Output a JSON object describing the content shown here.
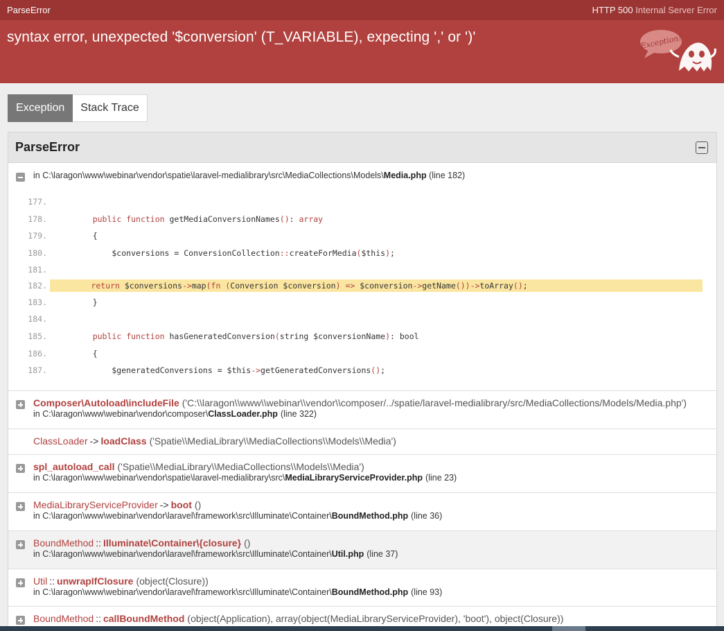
{
  "header": {
    "error_class": "ParseError",
    "http_code": "HTTP 500",
    "http_text": "Internal Server Error",
    "message": "syntax error, unexpected '$conversion' (T_VARIABLE), expecting ',' or ')'",
    "mascot_text": "Exception!"
  },
  "tabs": [
    {
      "label": "Exception",
      "active": true
    },
    {
      "label": "Stack Trace",
      "active": false
    }
  ],
  "panel": {
    "title": "ParseError",
    "location": {
      "prefix": "in C:\\laragon\\www\\webinar\\vendor\\spatie\\laravel-medialibrary\\src\\MediaCollections\\Models\\",
      "file": "Media.php",
      "line": "(line 182)"
    },
    "code": [
      {
        "num": "177.",
        "text": ""
      },
      {
        "num": "178.",
        "text": "    public function getMediaConversionNames(): array"
      },
      {
        "num": "179.",
        "text": "    {"
      },
      {
        "num": "180.",
        "text": "        $conversions = ConversionCollection::createForMedia($this);"
      },
      {
        "num": "181.",
        "text": ""
      },
      {
        "num": "182.",
        "text": "        return $conversions->map(fn (Conversion $conversion) => $conversion->getName())->toArray();",
        "highlight": true
      },
      {
        "num": "183.",
        "text": "    }"
      },
      {
        "num": "184.",
        "text": ""
      },
      {
        "num": "185.",
        "text": "    public function hasGeneratedConversion(string $conversionName): bool"
      },
      {
        "num": "186.",
        "text": "    {"
      },
      {
        "num": "187.",
        "text": "        $generatedConversions = $this->getGeneratedConversions();"
      }
    ]
  },
  "trace": [
    {
      "cls": "",
      "sep": "",
      "fn": "Composer\\Autoload\\includeFile",
      "args": "('C:\\\\laragon\\\\www\\\\webinar\\\\vendor\\\\composer/../spatie/laravel-medialibrary/src/MediaCollections/Models/Media.php')",
      "path": "in C:\\laragon\\www\\webinar\\vendor\\composer\\",
      "file": "ClassLoader.php",
      "line": "(line 322)"
    },
    {
      "cls": "ClassLoader",
      "sep": "->",
      "fn": "loadClass",
      "args": "('Spatie\\\\MediaLibrary\\\\MediaCollections\\\\Models\\\\Media')",
      "path": "",
      "file": "",
      "line": ""
    },
    {
      "cls": "",
      "sep": "",
      "fn": "spl_autoload_call",
      "args": "('Spatie\\\\MediaLibrary\\\\MediaCollections\\\\Models\\\\Media')",
      "path": "in C:\\laragon\\www\\webinar\\vendor\\spatie\\laravel-medialibrary\\src\\",
      "file": "MediaLibraryServiceProvider.php",
      "line": "(line 23)"
    },
    {
      "cls": "MediaLibraryServiceProvider",
      "sep": "->",
      "fn": "boot",
      "args": "()",
      "path": "in C:\\laragon\\www\\webinar\\vendor\\laravel\\framework\\src\\Illuminate\\Container\\",
      "file": "BoundMethod.php",
      "line": "(line 36)"
    },
    {
      "cls": "BoundMethod",
      "sep": "::",
      "fn": "Illuminate\\Container\\{closure}",
      "args": "()",
      "path": "in C:\\laragon\\www\\webinar\\vendor\\laravel\\framework\\src\\Illuminate\\Container\\",
      "file": "Util.php",
      "line": "(line 37)"
    },
    {
      "cls": "Util",
      "sep": "::",
      "fn": "unwrapIfClosure",
      "args": "(object(Closure))",
      "path": "in C:\\laragon\\www\\webinar\\vendor\\laravel\\framework\\src\\Illuminate\\Container\\",
      "file": "BoundMethod.php",
      "line": "(line 93)"
    },
    {
      "cls": "BoundMethod",
      "sep": "::",
      "fn": "callBoundMethod",
      "args": "(object(Application), array(object(MediaLibraryServiceProvider), 'boot'), object(Closure))",
      "path": "",
      "file": "",
      "line": ""
    }
  ]
}
